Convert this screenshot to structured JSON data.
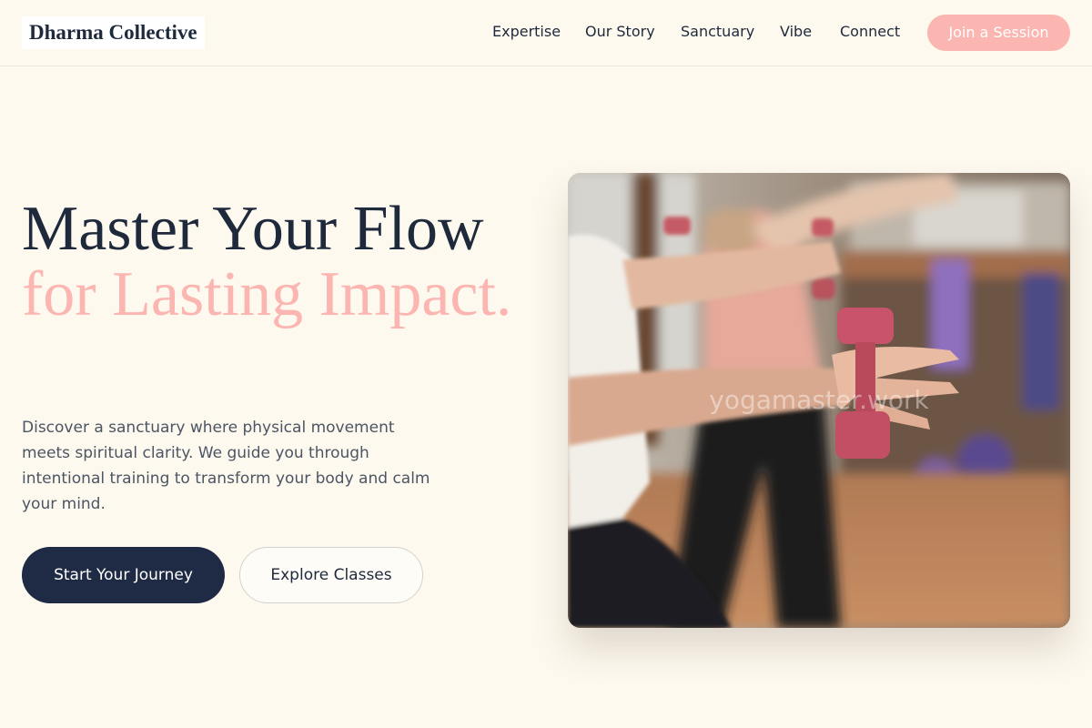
{
  "header": {
    "logo": "Dharma Collective",
    "nav": [
      "Expertise",
      "Our Story",
      "Sanctuary",
      "Vibe",
      "Connect"
    ],
    "cta": "Join a Session"
  },
  "hero": {
    "title_line1": "Master Your Flow",
    "title_line2": "for Lasting Impact.",
    "description": "Discover a sanctuary where physical movement meets spiritual clarity. We guide you through intentional training to transform your body and calm your mind.",
    "primary_button": "Start Your Journey",
    "secondary_button": "Explore Classes",
    "image_watermark": "yogamaster.work"
  },
  "colors": {
    "background": "#fef9ef",
    "text_dark": "#1e293b",
    "accent_pink": "#fbb6b1",
    "button_dark": "#1f2a44"
  }
}
